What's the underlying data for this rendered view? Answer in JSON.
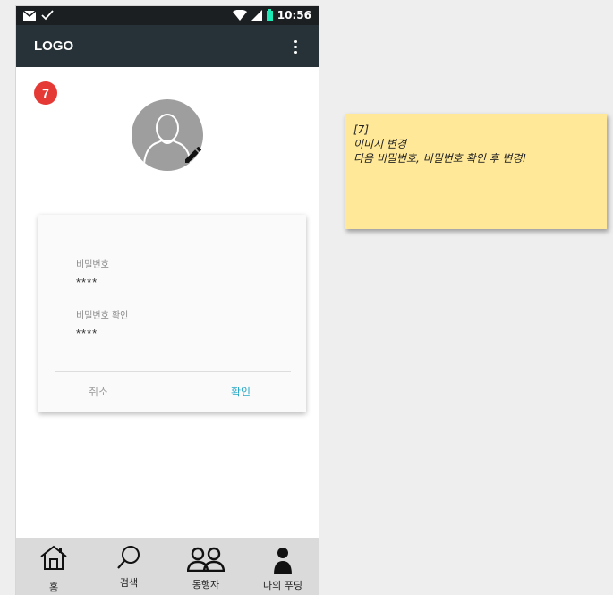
{
  "status_bar": {
    "time": "10:56",
    "left_icons": [
      "mail-icon",
      "check-icon"
    ],
    "right_icons": [
      "wifi-icon",
      "signal-icon",
      "battery-icon"
    ]
  },
  "app_bar": {
    "logo": "LOGO",
    "menu_icon": "more-vert-icon"
  },
  "annotation_badge": "7",
  "profile": {
    "avatar_icon": "person-outline-icon",
    "edit_icon": "pencil-icon"
  },
  "password_card": {
    "password_label": "비밀번호",
    "password_value": "****",
    "confirm_label": "비밀번호 확인",
    "confirm_value": "****",
    "cancel_button": "취소",
    "confirm_button": "확인"
  },
  "bottom_nav": {
    "items": [
      {
        "label": "홈",
        "icon": "home-icon"
      },
      {
        "label": "검색",
        "icon": "search-icon"
      },
      {
        "label": "동행자",
        "icon": "people-icon"
      },
      {
        "label": "나의 푸딩",
        "icon": "person-icon"
      }
    ]
  },
  "note": {
    "line1": "[7]",
    "line2": "이미지 변경",
    "line3": "다음 비밀번호, 비밀번호 확인 후 변경!"
  },
  "colors": {
    "app_bar": "#263238",
    "badge": "#e53935",
    "confirm_accent": "#26a8c7",
    "note_background": "#ffe898"
  }
}
